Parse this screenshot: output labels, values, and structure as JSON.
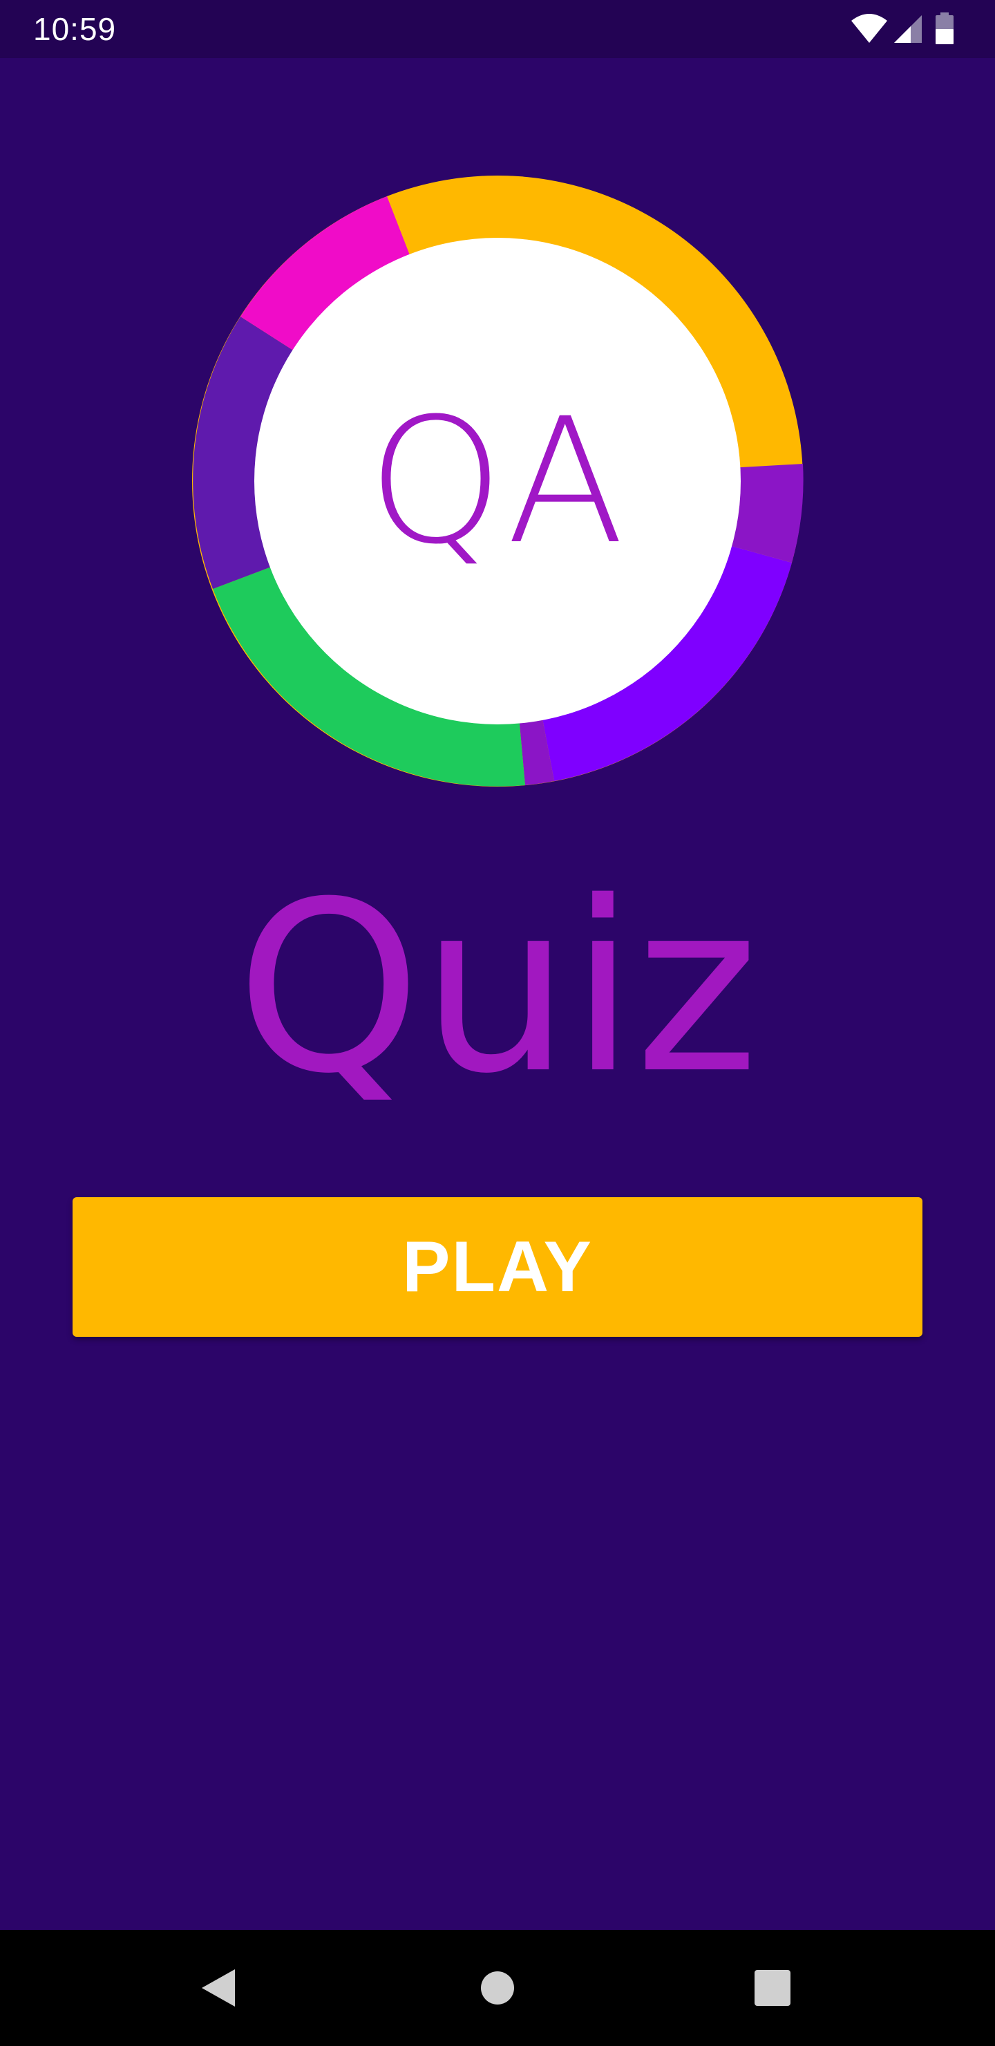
{
  "status_bar": {
    "time": "10:59",
    "icons": [
      "wifi-icon",
      "cellular-signal-icon",
      "battery-icon"
    ]
  },
  "logo": {
    "text": "QA",
    "ring_colors": [
      "#ffb800",
      "#8b15c6",
      "#7f00ff",
      "#1ecb5c",
      "#5f1aad",
      "#f00cc8"
    ],
    "text_color": "#a018c6"
  },
  "title": "Quiz",
  "play_button": {
    "label": "PLAY",
    "color": "#ffb800"
  },
  "nav_bar": {
    "items": [
      "back-icon",
      "home-icon",
      "recents-icon"
    ]
  },
  "colors": {
    "background": "#2c0569",
    "status_bar": "#230354",
    "title": "#a118c0"
  }
}
